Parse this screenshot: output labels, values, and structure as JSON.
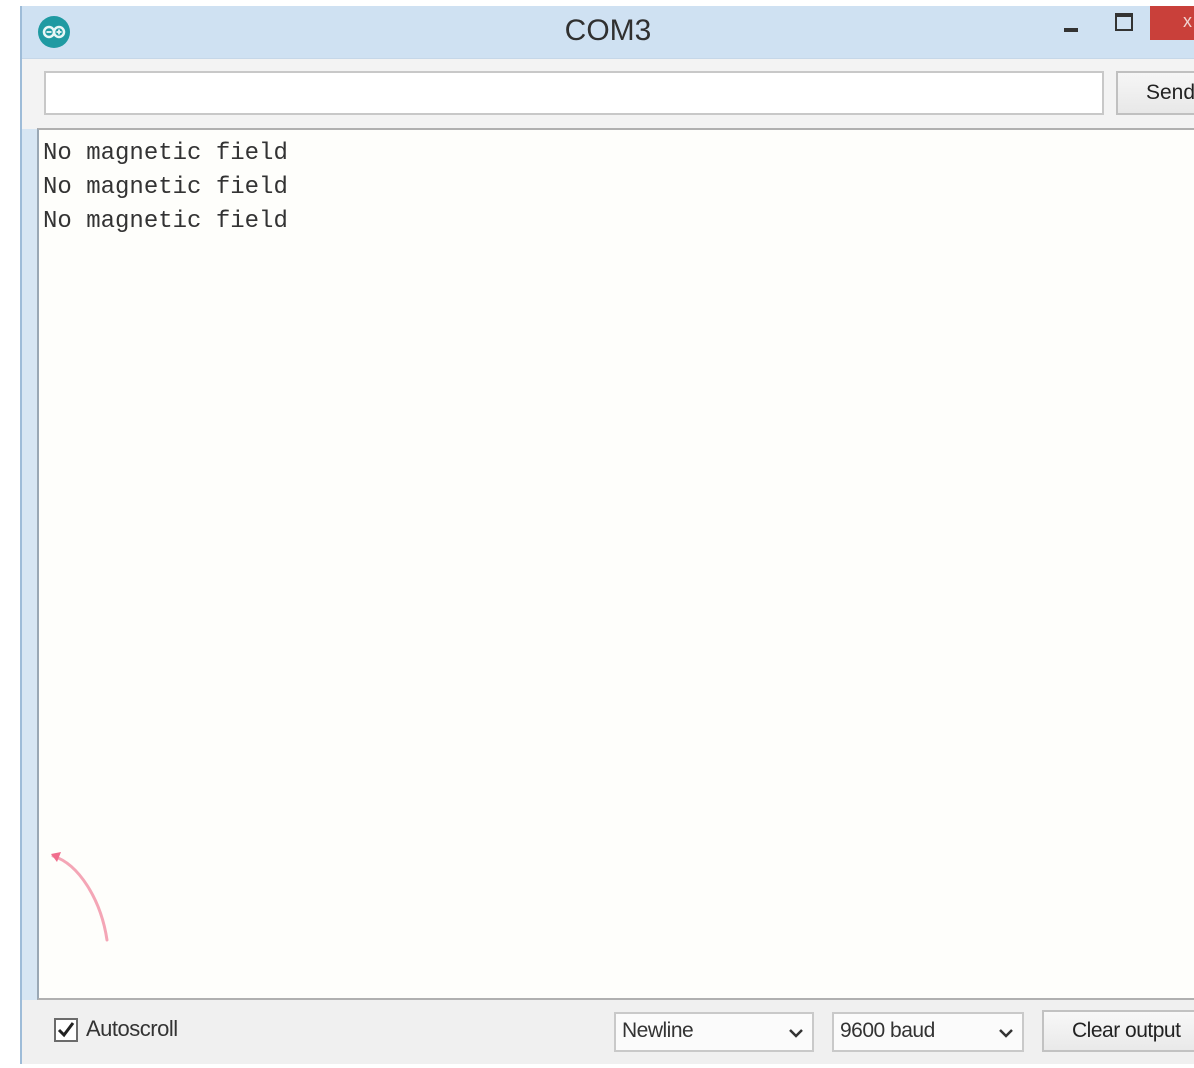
{
  "window": {
    "title": "COM3",
    "icon": "arduino-icon",
    "controls": {
      "minimize": "minimize-icon",
      "maximize": "maximize-icon",
      "close": "x"
    }
  },
  "input": {
    "value": "",
    "send_label": "Send"
  },
  "output": {
    "lines": [
      "No magnetic field",
      "No magnetic field",
      "No magnetic field"
    ]
  },
  "footer": {
    "autoscroll_label": "Autoscroll",
    "autoscroll_checked": true,
    "line_ending": "Newline",
    "baud_rate": "9600 baud",
    "clear_label": "Clear output"
  },
  "colors": {
    "title_bar": "#cfe1f2",
    "close_button": "#c9403a",
    "icon_teal": "#1f9aa2",
    "output_background": "#fefefb"
  }
}
